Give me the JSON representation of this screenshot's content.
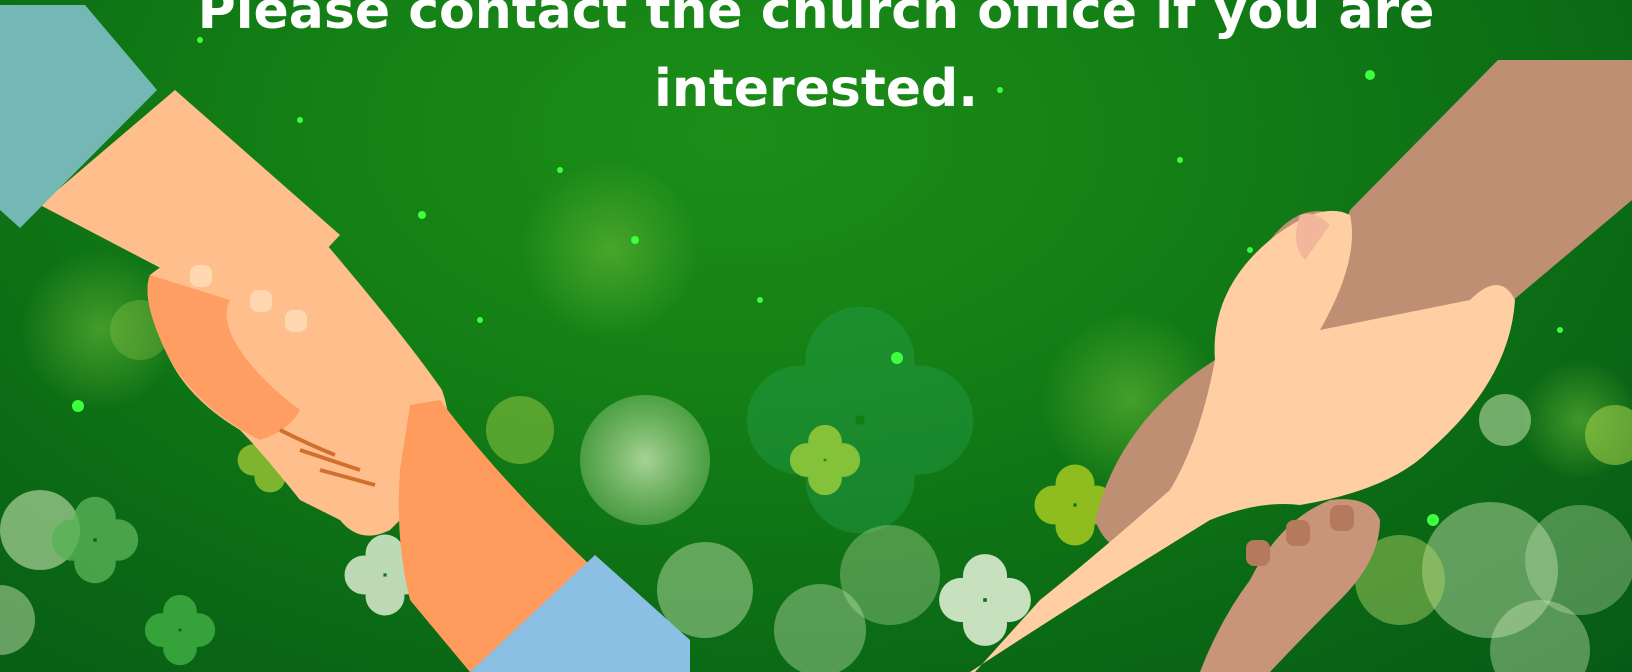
{
  "message": {
    "line1": "Please contact the church office if you are",
    "line2": "interested."
  },
  "colors": {
    "background": "#137f15",
    "text": "#ffffff",
    "left_sleeve_top": "#74b8b6",
    "left_sleeve_bottom": "#8bbfe3",
    "skin_light": "#ffbf8c",
    "skin_dark": "#ff9b5c",
    "right_sleeve": "#bf8f73",
    "right_skin": "#ffcfa3"
  },
  "icons": [
    "shamrock-icon",
    "handshake-illustration",
    "bokeh-light"
  ]
}
